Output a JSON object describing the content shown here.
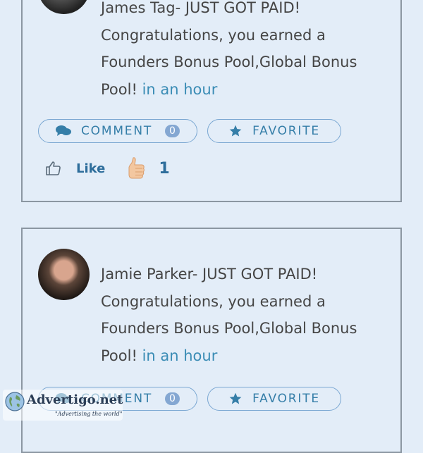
{
  "posts": [
    {
      "author_line": "James Tag- JUST GOT PAID!",
      "message": "Congratulations, you earned a Founders Bonus Pool,Global Bonus Pool!",
      "time": "in an hour",
      "comment_label": "COMMENT",
      "comment_count": "0",
      "favorite_label": "FAVORITE",
      "like_label": "Like",
      "like_count": "1"
    },
    {
      "author_line": "Jamie Parker- JUST GOT PAID!",
      "message": "Congratulations, you earned a Founders Bonus Pool,Global Bonus Pool!",
      "time": "in an hour",
      "comment_label": "COMMENT",
      "comment_count": "0",
      "favorite_label": "FAVORITE"
    }
  ],
  "watermark": {
    "brand": "Advertigo.net",
    "tagline": "\"Advertising the world\""
  },
  "colors": {
    "background": "#e3edf8",
    "accent": "#357ea8",
    "time_link": "#3a8cb5",
    "badge": "#84a7d2"
  }
}
